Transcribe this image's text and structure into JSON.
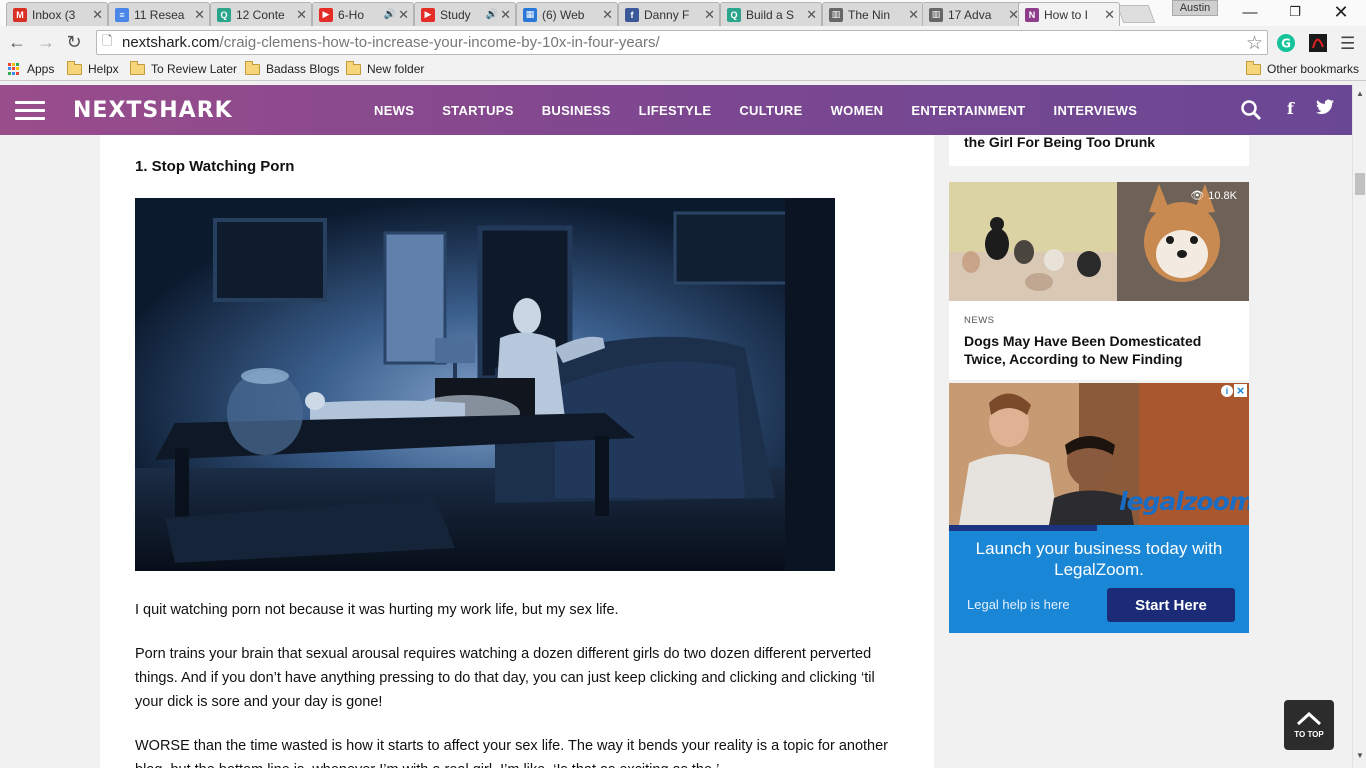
{
  "browser": {
    "tabs": [
      {
        "title": "Inbox (3",
        "fav": "M",
        "color": "#d93025",
        "audio": false
      },
      {
        "title": "11 Resea",
        "fav": "≡",
        "color": "#4a86e8",
        "audio": false
      },
      {
        "title": "12 Conte",
        "fav": "Q",
        "color": "#2aa58c",
        "audio": false
      },
      {
        "title": "6-Ho",
        "fav": "▶",
        "color": "#e52d27",
        "audio": true
      },
      {
        "title": "Study",
        "fav": "▶",
        "color": "#e52d27",
        "audio": true
      },
      {
        "title": "(6) Web",
        "fav": "▦",
        "color": "#2a79d8",
        "audio": false
      },
      {
        "title": "Danny F",
        "fav": "f",
        "color": "#3b5998",
        "audio": false
      },
      {
        "title": "Build a S",
        "fav": "Q",
        "color": "#2aa58c",
        "audio": false
      },
      {
        "title": "The Nin",
        "fav": "▥",
        "color": "#666666",
        "audio": false
      },
      {
        "title": "17 Adva",
        "fav": "▥",
        "color": "#666666",
        "audio": false
      },
      {
        "title": "How to I",
        "fav": "N",
        "color": "#8e3d8a",
        "audio": false
      }
    ],
    "profile_name": "Austin",
    "url_host": "nextshark.com",
    "url_path": "/craig-clemens-how-to-increase-your-income-by-10x-in-four-years/",
    "bookmarks": [
      {
        "label": "Apps",
        "type": "apps"
      },
      {
        "label": "Helpx",
        "type": "folder"
      },
      {
        "label": "To Review Later",
        "type": "folder"
      },
      {
        "label": "Badass Blogs",
        "type": "folder"
      },
      {
        "label": "New folder",
        "type": "folder"
      }
    ],
    "other_bookmarks": "Other bookmarks"
  },
  "site": {
    "logo": "NEXTSHARK",
    "nav": [
      "NEWS",
      "STARTUPS",
      "BUSINESS",
      "LIFESTYLE",
      "CULTURE",
      "WOMEN",
      "ENTERTAINMENT",
      "INTERVIEWS"
    ]
  },
  "article": {
    "heading": "1. Stop Watching Porn",
    "paragraphs": [
      "I quit watching porn not because it was hurting my work life, but my sex life.",
      "Porn trains your brain that sexual arousal requires watching a dozen different girls do two dozen different perverted things. And if you don’t have anything pressing to do that day, you can just keep clicking and clicking and clicking ‘til your dick is sore and your day is gone!",
      "WORSE than the time wasted is how it starts to affect your sex life. The way it bends your reality is a topic for another blog, but the bottom line is, whenever I’m with a real girl, I’m like, ‘Is that as exciting as the ’..."
    ]
  },
  "sidebar": {
    "prev_title": "the Girl For Being Too Drunk",
    "story": {
      "views": "10.8K",
      "category": "NEWS",
      "title": "Dogs May Have Been Domesticated Twice, According to New Finding"
    },
    "ad": {
      "brand": "legalzoom",
      "headline": "Launch your business today with LegalZoom.",
      "sub": "Legal help is here",
      "cta": "Start Here"
    }
  },
  "totop": "TO TOP"
}
